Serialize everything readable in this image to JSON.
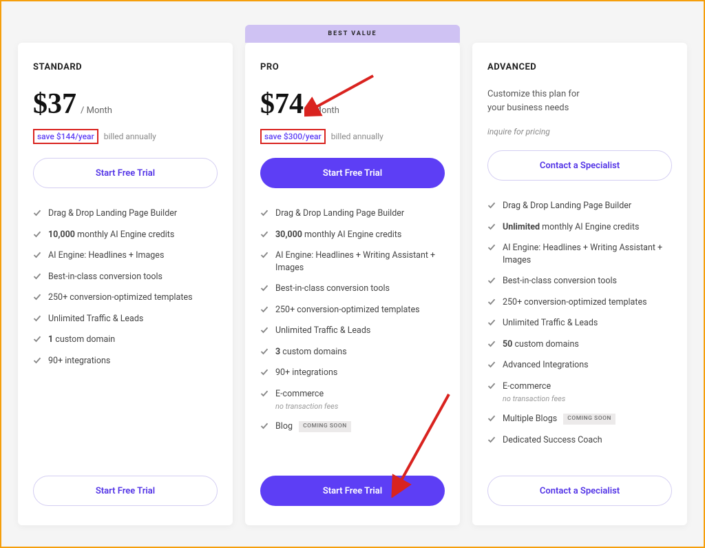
{
  "ui": {
    "best_value_label": "BEST VALUE",
    "per_month": "/ Month",
    "billed_annually": "billed annually",
    "coming_soon": "COMING SOON",
    "start_free_trial": "Start Free Trial",
    "contact_specialist": "Contact a Specialist"
  },
  "plans": [
    {
      "name": "STANDARD",
      "price": "$37",
      "savings": "save $144/year",
      "savings_highlighted": true,
      "cta_style": "outline",
      "cta_label_key": "start_free_trial",
      "bottom_cta_label_key": "start_free_trial",
      "features": [
        {
          "text": "Drag & Drop Landing Page Builder"
        },
        {
          "html": "<span class='bold'>10,000</span> monthly AI Engine credits"
        },
        {
          "text": "AI Engine: Headlines + Images"
        },
        {
          "text": "Best-in-class conversion tools"
        },
        {
          "text": "250+ conversion-optimized templates"
        },
        {
          "text": "Unlimited Traffic & Leads"
        },
        {
          "html": "<span class='bold'>1</span> custom domain"
        },
        {
          "text": "90+ integrations"
        }
      ]
    },
    {
      "name": "PRO",
      "price": "$74",
      "savings": "save $300/year",
      "savings_highlighted": true,
      "featured": true,
      "cta_style": "filled",
      "cta_label_key": "start_free_trial",
      "bottom_cta_label_key": "start_free_trial",
      "features": [
        {
          "text": "Drag & Drop Landing Page Builder"
        },
        {
          "html": "<span class='bold'>30,000</span> monthly AI Engine credits"
        },
        {
          "text": "AI Engine: Headlines + Writing Assistant + Images"
        },
        {
          "text": "Best-in-class conversion tools"
        },
        {
          "text": "250+ conversion-optimized templates"
        },
        {
          "text": "Unlimited Traffic & Leads"
        },
        {
          "html": "<span class='bold'>3</span> custom domains"
        },
        {
          "text": "90+ integrations"
        },
        {
          "text": "E-commerce",
          "sub": "no transaction fees"
        },
        {
          "text": "Blog",
          "coming_soon": true
        }
      ]
    },
    {
      "name": "ADVANCED",
      "custom_line1": "Customize this plan for",
      "custom_line2": "your business needs",
      "inquire": "inquire for pricing",
      "cta_style": "outline",
      "cta_label_key": "contact_specialist",
      "bottom_cta_label_key": "contact_specialist",
      "features": [
        {
          "text": "Drag & Drop Landing Page Builder"
        },
        {
          "html": "<span class='bold'>Unlimited</span> monthly AI Engine credits"
        },
        {
          "text": "AI Engine: Headlines + Writing Assistant + Images"
        },
        {
          "text": "Best-in-class conversion tools"
        },
        {
          "text": "250+ conversion-optimized templates"
        },
        {
          "text": "Unlimited Traffic & Leads"
        },
        {
          "html": "<span class='bold'>50</span> custom domains"
        },
        {
          "text": "Advanced Integrations"
        },
        {
          "text": "E-commerce",
          "sub": "no transaction fees"
        },
        {
          "text": "Multiple Blogs",
          "coming_soon": true
        },
        {
          "text": "Dedicated Success Coach"
        }
      ]
    }
  ]
}
